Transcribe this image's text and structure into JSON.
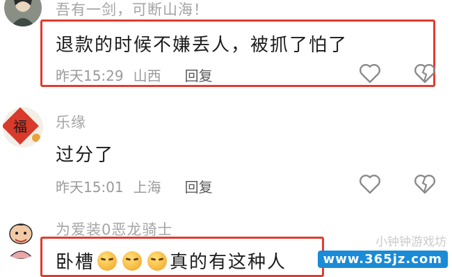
{
  "comments": [
    {
      "username": "吾有一剑，可断山海！",
      "text": "退款的时候不嫌丢人，被抓了怕了",
      "time": "昨天15:29",
      "location": "山西",
      "reply_label": "回复",
      "avatar_icon": "warrior-avatar",
      "highlighted": true
    },
    {
      "username": "乐缘",
      "text": "过分了",
      "time": "昨天15:01",
      "location": "上海",
      "reply_label": "回复",
      "avatar_icon": "fu-character-avatar",
      "avatar_text": "福",
      "highlighted": false
    },
    {
      "username": "为爱装0恶龙骑士",
      "text_before": "卧槽",
      "text_after": "真的有这种人",
      "emoji_count": 3,
      "avatar_icon": "cartoon-avatar",
      "highlighted": true
    }
  ],
  "icons": {
    "like": "heart-icon",
    "dislike": "broken-heart-icon"
  },
  "watermark": {
    "site": "www.365jz.com",
    "ghost": "小钟钟游戏坊"
  },
  "colors": {
    "highlight": "#e23b2e",
    "username": "#a4a4a4",
    "reply": "#5a5a5a"
  }
}
